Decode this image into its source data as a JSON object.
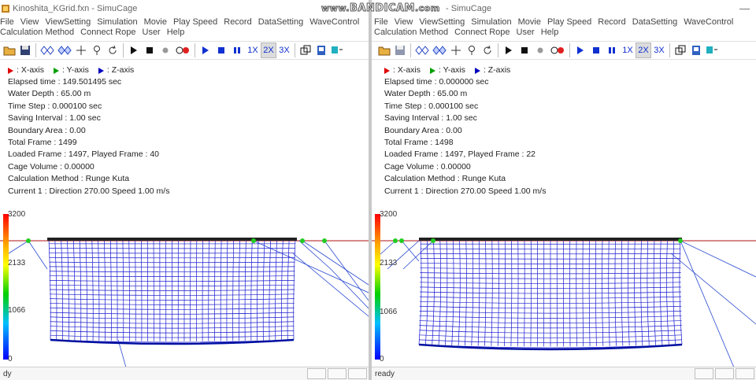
{
  "watermark": {
    "prefix": "www.",
    "brand": "BANDICAM",
    "suffix": ".com"
  },
  "windows": [
    {
      "title": "Kinoshita_KGrid.fxn - SimuCage",
      "menu_row1": [
        "File",
        "View",
        "ViewSetting",
        "Simulation",
        "Movie",
        "Play Speed",
        "Record",
        "DataSetting",
        "WaveControl"
      ],
      "menu_row2": [
        "Calculation Method",
        "Connect Rope",
        "User",
        "Help"
      ],
      "legend": {
        "x": ": X-axis",
        "y": ": Y-axis",
        "z": ": Z-axis"
      },
      "info": {
        "elapsed": "Elapsed time : 149.501495 sec",
        "depth": "Water Depth : 65.00 m",
        "timestep": "Time Step : 0.000100 sec",
        "saving": "Saving Interval : 1.00 sec",
        "boundary": "Boundary Area : 0.00",
        "total": "Total Frame : 1499",
        "loaded": "Loaded Frame : 1497, Played Frame : 40",
        "volume": "Cage Volume : 0.00000",
        "method": "Calculation Method : Runge Kuta",
        "current": "Current 1 : Direction 270.00 Speed 1.00 m/s"
      },
      "colorbar": {
        "top": "3200",
        "mid1": "2133",
        "mid2": "1066",
        "bottom": "0"
      },
      "status": "dy"
    },
    {
      "title": "- SimuCage",
      "menu_row1": [
        "File",
        "View",
        "ViewSetting",
        "Simulation",
        "Movie",
        "Play Speed",
        "Record",
        "DataSetting",
        "WaveControl"
      ],
      "menu_row2": [
        "Calculation Method",
        "Connect Rope",
        "User",
        "Help"
      ],
      "legend": {
        "x": ": X-axis",
        "y": ": Y-axis",
        "z": ": Z-axis"
      },
      "info": {
        "elapsed": "Elapsed time : 0.000000 sec",
        "depth": "Water Depth : 65.00 m",
        "timestep": "Time Step : 0.000100 sec",
        "saving": "Saving Interval : 1.00 sec",
        "boundary": "Boundary Area : 0.00",
        "total": "Total Frame : 1498",
        "loaded": "Loaded Frame : 1497, Played Frame : 22",
        "volume": "Cage Volume : 0.00000",
        "method": "Calculation Method : Runge Kuta",
        "current": "Current 1 : Direction 270.00 Speed 1.00 m/s"
      },
      "colorbar": {
        "top": "3200",
        "mid1": "2133",
        "mid2": "1066",
        "bottom": "0"
      },
      "status": "ready"
    }
  ],
  "toolbar": {
    "speed_1x": "1X",
    "speed_2x": "2X",
    "speed_3x": "3X"
  },
  "colors": {
    "x_axis": "#e00000",
    "y_axis": "#00a000",
    "z_axis": "#0000c0",
    "net": "#1a1ad0",
    "float": "#222222",
    "buoy": "#22cc22",
    "water": "#c04040"
  }
}
